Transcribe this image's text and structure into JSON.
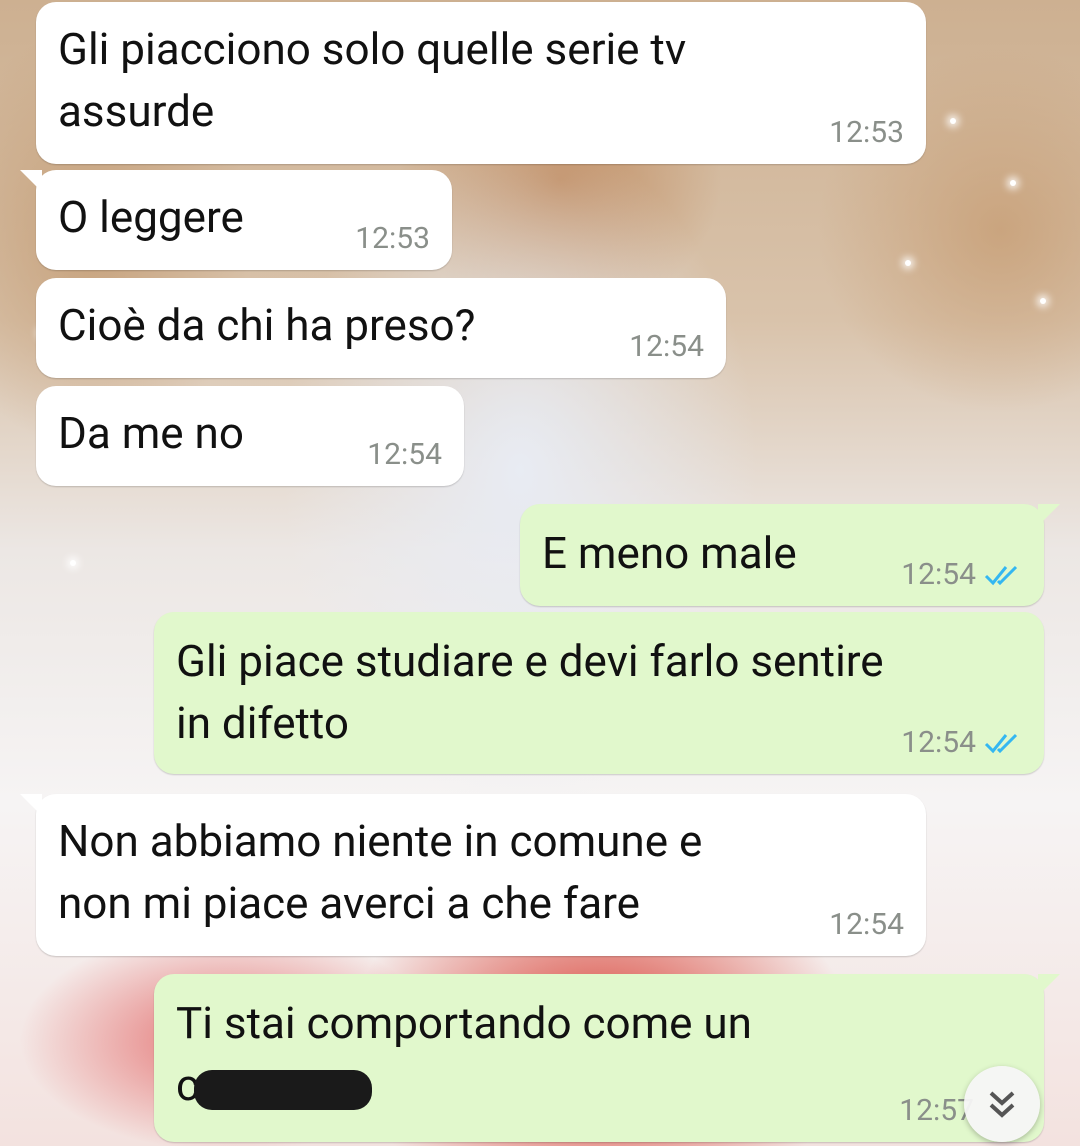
{
  "messages": [
    {
      "dir": "in",
      "text": "Gli piacciono solo quelle serie tv\nassurde",
      "time": "12:53"
    },
    {
      "dir": "in",
      "text": "O leggere",
      "time": "12:53"
    },
    {
      "dir": "in",
      "text": "Cioè da chi ha preso?",
      "time": "12:54"
    },
    {
      "dir": "in",
      "text": "Da me no",
      "time": "12:54"
    },
    {
      "dir": "out",
      "text": "E meno male",
      "time": "12:54",
      "status": "read"
    },
    {
      "dir": "out",
      "text": "Gli piace studiare e devi farlo sentire\nin difetto",
      "time": "12:54",
      "status": "read"
    },
    {
      "dir": "in",
      "text": "Non abbiamo niente in comune e\nnon mi piace averci a che fare",
      "time": "12:54"
    },
    {
      "dir": "out",
      "text": "Ti stai comportando come un\nc",
      "time": "12:57",
      "status": "read",
      "redacted": true
    }
  ],
  "colors": {
    "incoming_bubble": "#ffffff",
    "outgoing_bubble": "#e1f8cc",
    "read_ticks": "#34b7f1",
    "timestamp": "#8a8f8a"
  },
  "icons": {
    "read_receipt": "double-check-icon",
    "scroll": "chevron-double-down-icon"
  }
}
